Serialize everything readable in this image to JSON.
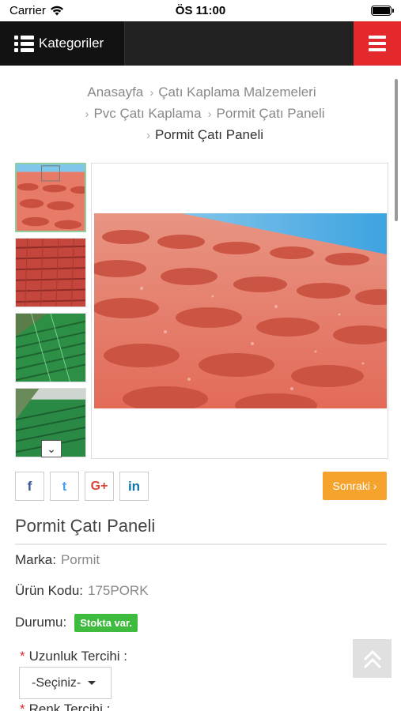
{
  "statusbar": {
    "carrier": "Carrier",
    "time": "ÖS 11:00"
  },
  "navbar": {
    "categories_label": "Kategoriler"
  },
  "breadcrumb": {
    "items": [
      "Anasayfa",
      "Çatı Kaplama Malzemeleri",
      "Pvc Çatı Kaplama",
      "Pormit Çatı Paneli"
    ],
    "current": "Pormit Çatı Paneli"
  },
  "gallery": {
    "thumbnail_colors": [
      "#d85a48",
      "#c9423a",
      "#2f9e4c",
      "#2a8a45"
    ]
  },
  "social": {
    "facebook": "f",
    "twitter": "t",
    "googleplus": "G+",
    "linkedin": "in"
  },
  "next_button": {
    "label": "Sonraki ›"
  },
  "product": {
    "title": "Pormit Çatı Paneli",
    "brand_label": "Marka:",
    "brand_value": "Pormit",
    "code_label": "Ürün Kodu:",
    "code_value": "175PORK",
    "status_label": "Durumu:",
    "status_value": "Stokta var."
  },
  "options": {
    "length_label": "Uzunluk Tercihi :",
    "length_selected": "-Seçiniz-",
    "color_label": "Renk Tercihi :"
  }
}
